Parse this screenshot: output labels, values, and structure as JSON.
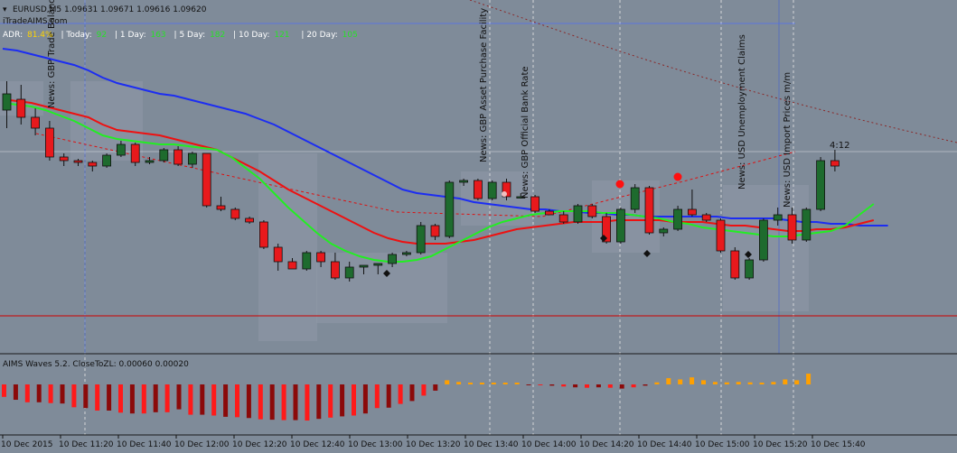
{
  "colors": {
    "background": "#7f8b99",
    "frame": "#1a1a1a",
    "bull": "#1e6b2e",
    "bear": "#e8191c",
    "ma_blue": "#1c2df2",
    "ma_red": "#ee1111",
    "ma_green": "#22ee22",
    "session_box": "#8f99a7",
    "wave_bear_bright": "#ff1a1a",
    "wave_bear_dark": "#8b0a0a",
    "wave_bull": "#ffa000"
  },
  "header": {
    "symbol_line": "EURUSD,M5  1.09631 1.09671 1.09616 1.09620",
    "site": "iTradeAIMS.com",
    "adr": {
      "prefix": "ADR:",
      "adr_value": "81.4%",
      "today_label": "| Today:",
      "today_value": "92",
      "day1_label": "| 1 Day:",
      "day1_value": "163",
      "day5_label": "| 5 Day:",
      "day5_value": "182",
      "day10_label": "| 10 Day:",
      "day10_value": "121",
      "day20_label": "| 20 Day:",
      "day20_value": "105"
    },
    "countdown": "4:12"
  },
  "news_labels": [
    "News: GBP Trade Balance",
    "News: GBP Asset Purchase Facility",
    "News: GBP Official Bank Rate",
    "News: USD Unemployment Claims",
    "News: USD Import Prices m/m"
  ],
  "indicator": {
    "title": "AIMS Waves 5.2. CloseToZL: 0.00060 0.00020"
  },
  "x_axis": {
    "labels": [
      "10 Dec 2015",
      "10 Dec 11:20",
      "10 Dec 11:40",
      "10 Dec 12:00",
      "10 Dec 12:20",
      "10 Dec 12:40",
      "10 Dec 13:00",
      "10 Dec 13:20",
      "10 Dec 13:40",
      "10 Dec 14:00",
      "10 Dec 14:20",
      "10 Dec 14:40",
      "10 Dec 15:00",
      "10 Dec 15:20",
      "10 Dec 15:40"
    ]
  },
  "chart_data": {
    "type": "candlestick",
    "symbol": "EURUSD",
    "timeframe": "M5",
    "candles": [
      {
        "o": 0.84,
        "h": 1.0,
        "l": 0.74,
        "c": 0.93
      },
      {
        "o": 0.9,
        "h": 0.98,
        "l": 0.76,
        "c": 0.8
      },
      {
        "o": 0.8,
        "h": 0.85,
        "l": 0.7,
        "c": 0.74
      },
      {
        "o": 0.74,
        "h": 0.78,
        "l": 0.56,
        "c": 0.58
      },
      {
        "o": 0.58,
        "h": 0.6,
        "l": 0.53,
        "c": 0.56
      },
      {
        "o": 0.56,
        "h": 0.57,
        "l": 0.53,
        "c": 0.55
      },
      {
        "o": 0.55,
        "h": 0.56,
        "l": 0.5,
        "c": 0.53
      },
      {
        "o": 0.53,
        "h": 0.6,
        "l": 0.52,
        "c": 0.59
      },
      {
        "o": 0.59,
        "h": 0.67,
        "l": 0.58,
        "c": 0.65
      },
      {
        "o": 0.65,
        "h": 0.66,
        "l": 0.53,
        "c": 0.55
      },
      {
        "o": 0.55,
        "h": 0.58,
        "l": 0.54,
        "c": 0.56
      },
      {
        "o": 0.56,
        "h": 0.63,
        "l": 0.55,
        "c": 0.62
      },
      {
        "o": 0.62,
        "h": 0.64,
        "l": 0.53,
        "c": 0.54
      },
      {
        "o": 0.54,
        "h": 0.61,
        "l": 0.52,
        "c": 0.6
      },
      {
        "o": 0.6,
        "h": 0.6,
        "l": 0.3,
        "c": 0.31
      },
      {
        "o": 0.31,
        "h": 0.36,
        "l": 0.28,
        "c": 0.29
      },
      {
        "o": 0.29,
        "h": 0.3,
        "l": 0.23,
        "c": 0.24
      },
      {
        "o": 0.24,
        "h": 0.25,
        "l": 0.21,
        "c": 0.22
      },
      {
        "o": 0.22,
        "h": 0.23,
        "l": 0.07,
        "c": 0.08
      },
      {
        "o": 0.08,
        "h": 0.1,
        "l": -0.05,
        "c": 0.0
      },
      {
        "o": 0.0,
        "h": 0.02,
        "l": -0.04,
        "c": -0.04
      },
      {
        "o": -0.04,
        "h": 0.06,
        "l": -0.05,
        "c": 0.05
      },
      {
        "o": 0.05,
        "h": 0.06,
        "l": -0.03,
        "c": 0.0
      },
      {
        "o": 0.0,
        "h": 0.05,
        "l": -0.1,
        "c": -0.09
      },
      {
        "o": -0.09,
        "h": 0.0,
        "l": -0.11,
        "c": -0.03
      },
      {
        "o": -0.03,
        "h": -0.02,
        "l": -0.07,
        "c": -0.02
      },
      {
        "o": -0.02,
        "h": -0.01,
        "l": -0.07,
        "c": -0.01
      },
      {
        "o": -0.01,
        "h": 0.05,
        "l": -0.03,
        "c": 0.04
      },
      {
        "o": 0.04,
        "h": 0.06,
        "l": 0.03,
        "c": 0.05
      },
      {
        "o": 0.05,
        "h": 0.22,
        "l": 0.04,
        "c": 0.2
      },
      {
        "o": 0.2,
        "h": 0.21,
        "l": 0.12,
        "c": 0.14
      },
      {
        "o": 0.14,
        "h": 0.45,
        "l": 0.13,
        "c": 0.44
      },
      {
        "o": 0.44,
        "h": 0.46,
        "l": 0.42,
        "c": 0.45
      },
      {
        "o": 0.45,
        "h": 0.46,
        "l": 0.34,
        "c": 0.35
      },
      {
        "o": 0.35,
        "h": 0.45,
        "l": 0.34,
        "c": 0.44
      },
      {
        "o": 0.44,
        "h": 0.46,
        "l": 0.34,
        "c": 0.36
      },
      {
        "o": 0.36,
        "h": 0.38,
        "l": 0.35,
        "c": 0.36
      },
      {
        "o": 0.36,
        "h": 0.37,
        "l": 0.27,
        "c": 0.28
      },
      {
        "o": 0.28,
        "h": 0.29,
        "l": 0.26,
        "c": 0.26
      },
      {
        "o": 0.26,
        "h": 0.28,
        "l": 0.21,
        "c": 0.22
      },
      {
        "o": 0.22,
        "h": 0.32,
        "l": 0.21,
        "c": 0.31
      },
      {
        "o": 0.31,
        "h": 0.32,
        "l": 0.24,
        "c": 0.25
      },
      {
        "o": 0.25,
        "h": 0.27,
        "l": 0.1,
        "c": 0.11
      },
      {
        "o": 0.11,
        "h": 0.3,
        "l": 0.1,
        "c": 0.29
      },
      {
        "o": 0.29,
        "h": 0.43,
        "l": 0.27,
        "c": 0.41
      },
      {
        "o": 0.41,
        "h": 0.42,
        "l": 0.15,
        "c": 0.16
      },
      {
        "o": 0.16,
        "h": 0.19,
        "l": 0.14,
        "c": 0.18
      },
      {
        "o": 0.18,
        "h": 0.31,
        "l": 0.17,
        "c": 0.29
      },
      {
        "o": 0.29,
        "h": 0.4,
        "l": 0.25,
        "c": 0.26
      },
      {
        "o": 0.26,
        "h": 0.27,
        "l": 0.22,
        "c": 0.23
      },
      {
        "o": 0.23,
        "h": 0.24,
        "l": 0.05,
        "c": 0.06
      },
      {
        "o": 0.06,
        "h": 0.08,
        "l": -0.1,
        "c": -0.09
      },
      {
        "o": -0.09,
        "h": 0.02,
        "l": -0.1,
        "c": 0.01
      },
      {
        "o": 0.01,
        "h": 0.24,
        "l": 0.0,
        "c": 0.23
      },
      {
        "o": 0.23,
        "h": 0.3,
        "l": 0.2,
        "c": 0.26
      },
      {
        "o": 0.26,
        "h": 0.3,
        "l": 0.1,
        "c": 0.12
      },
      {
        "o": 0.12,
        "h": 0.3,
        "l": 0.11,
        "c": 0.29
      },
      {
        "o": 0.29,
        "h": 0.58,
        "l": 0.28,
        "c": 0.56
      },
      {
        "o": 0.56,
        "h": 0.62,
        "l": 0.5,
        "c": 0.53
      }
    ],
    "ma_blue": [
      1.18,
      1.17,
      1.15,
      1.13,
      1.11,
      1.09,
      1.06,
      1.02,
      0.99,
      0.97,
      0.95,
      0.93,
      0.92,
      0.9,
      0.88,
      0.86,
      0.84,
      0.82,
      0.79,
      0.76,
      0.72,
      0.68,
      0.64,
      0.6,
      0.56,
      0.52,
      0.48,
      0.44,
      0.4,
      0.38,
      0.37,
      0.36,
      0.35,
      0.33,
      0.32,
      0.31,
      0.3,
      0.29,
      0.29,
      0.28,
      0.28,
      0.27,
      0.27,
      0.26,
      0.26,
      0.25,
      0.25,
      0.25,
      0.25,
      0.25,
      0.25,
      0.24,
      0.24,
      0.24,
      0.24,
      0.23,
      0.22,
      0.22,
      0.21,
      0.21,
      0.2,
      0.2,
      0.2
    ],
    "ma_red": [
      0.9,
      0.89,
      0.88,
      0.86,
      0.84,
      0.82,
      0.8,
      0.76,
      0.73,
      0.72,
      0.71,
      0.7,
      0.68,
      0.66,
      0.64,
      0.62,
      0.58,
      0.54,
      0.5,
      0.45,
      0.4,
      0.36,
      0.32,
      0.28,
      0.24,
      0.2,
      0.16,
      0.13,
      0.11,
      0.1,
      0.1,
      0.1,
      0.11,
      0.12,
      0.14,
      0.16,
      0.18,
      0.19,
      0.2,
      0.21,
      0.22,
      0.22,
      0.22,
      0.23,
      0.23,
      0.23,
      0.23,
      0.22,
      0.22,
      0.22,
      0.21,
      0.2,
      0.2,
      0.19,
      0.18,
      0.17,
      0.17,
      0.18,
      0.18,
      0.19,
      0.21,
      0.23
    ],
    "ma_green": [
      0.88,
      0.87,
      0.86,
      0.84,
      0.81,
      0.78,
      0.74,
      0.7,
      0.68,
      0.67,
      0.66,
      0.65,
      0.65,
      0.64,
      0.63,
      0.62,
      0.58,
      0.52,
      0.46,
      0.38,
      0.3,
      0.23,
      0.16,
      0.1,
      0.06,
      0.03,
      0.01,
      0.0,
      0.0,
      0.01,
      0.03,
      0.07,
      0.11,
      0.15,
      0.19,
      0.22,
      0.24,
      0.26,
      0.27,
      0.28,
      0.28,
      0.28,
      0.27,
      0.27,
      0.26,
      0.25,
      0.24,
      0.22,
      0.21,
      0.19,
      0.18,
      0.17,
      0.16,
      0.15,
      0.14,
      0.14,
      0.15,
      0.16,
      0.17,
      0.2,
      0.26,
      0.32
    ],
    "waves": [
      -0.3,
      -0.37,
      -0.43,
      -0.43,
      -0.45,
      -0.46,
      -0.55,
      -0.57,
      -0.63,
      -0.63,
      -0.68,
      -0.7,
      -0.7,
      -0.67,
      -0.67,
      -0.6,
      -0.73,
      -0.73,
      -0.75,
      -0.78,
      -0.79,
      -0.81,
      -0.84,
      -0.85,
      -0.86,
      -0.86,
      -0.87,
      -0.83,
      -0.8,
      -0.77,
      -0.75,
      -0.7,
      -0.57,
      -0.56,
      -0.47,
      -0.4,
      -0.27,
      -0.15,
      0.1,
      0.06,
      0.02,
      0.02,
      0.02,
      0.02,
      0.0,
      -0.02,
      -0.02,
      -0.03,
      -0.05,
      -0.07,
      -0.08,
      -0.07,
      -0.08,
      -0.1,
      -0.07,
      -0.03,
      0.05,
      0.15,
      0.12,
      0.17,
      0.1,
      0.06,
      0.05,
      0.06,
      0.05,
      0.04,
      0.06,
      0.12,
      0.1,
      0.26
    ]
  }
}
